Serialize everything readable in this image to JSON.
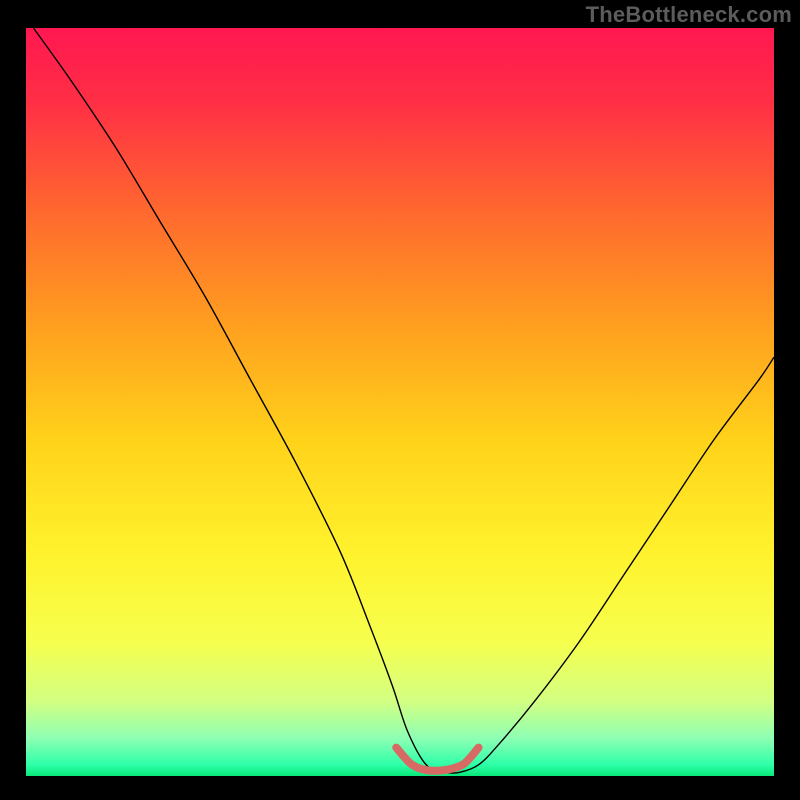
{
  "watermark": "TheBottleneck.com",
  "chart_data": {
    "type": "line",
    "title": "",
    "xlabel": "",
    "ylabel": "",
    "xlim": [
      0,
      100
    ],
    "ylim": [
      0,
      100
    ],
    "grid": false,
    "legend": false,
    "background": {
      "type": "vertical-gradient",
      "stops": [
        {
          "offset": 0.0,
          "color": "#ff1751"
        },
        {
          "offset": 0.1,
          "color": "#ff2f45"
        },
        {
          "offset": 0.25,
          "color": "#ff6a2e"
        },
        {
          "offset": 0.4,
          "color": "#ffa01f"
        },
        {
          "offset": 0.55,
          "color": "#ffd21a"
        },
        {
          "offset": 0.7,
          "color": "#fff22c"
        },
        {
          "offset": 0.82,
          "color": "#f6ff4d"
        },
        {
          "offset": 0.9,
          "color": "#d3ff82"
        },
        {
          "offset": 0.95,
          "color": "#8dffb4"
        },
        {
          "offset": 0.985,
          "color": "#2effa8"
        },
        {
          "offset": 1.0,
          "color": "#08e87a"
        }
      ]
    },
    "series": [
      {
        "name": "bottleneck-curve",
        "color": "#000000",
        "width": 1.4,
        "x": [
          1,
          6,
          12,
          18,
          24,
          30,
          36,
          42,
          46,
          49,
          51,
          53.5,
          56,
          58,
          60.5,
          63,
          68,
          74,
          80,
          86,
          92,
          98,
          100
        ],
        "y": [
          100,
          93,
          84,
          74,
          64,
          53,
          42,
          30,
          20,
          12,
          6,
          1.5,
          0.5,
          0.5,
          1.5,
          4,
          10,
          18,
          27,
          36,
          45,
          53,
          56
        ]
      },
      {
        "name": "optimal-zone-marker",
        "color": "#d76a64",
        "width": 8,
        "linecap": "round",
        "x": [
          49.5,
          51.5,
          53.5,
          56,
          58.5,
          60.5
        ],
        "y": [
          3.8,
          1.6,
          0.8,
          0.8,
          1.6,
          3.8
        ]
      }
    ],
    "frame": {
      "left_border": true,
      "right_border": true,
      "bottom_border": false,
      "top_border": false,
      "border_color": "#000000"
    }
  }
}
